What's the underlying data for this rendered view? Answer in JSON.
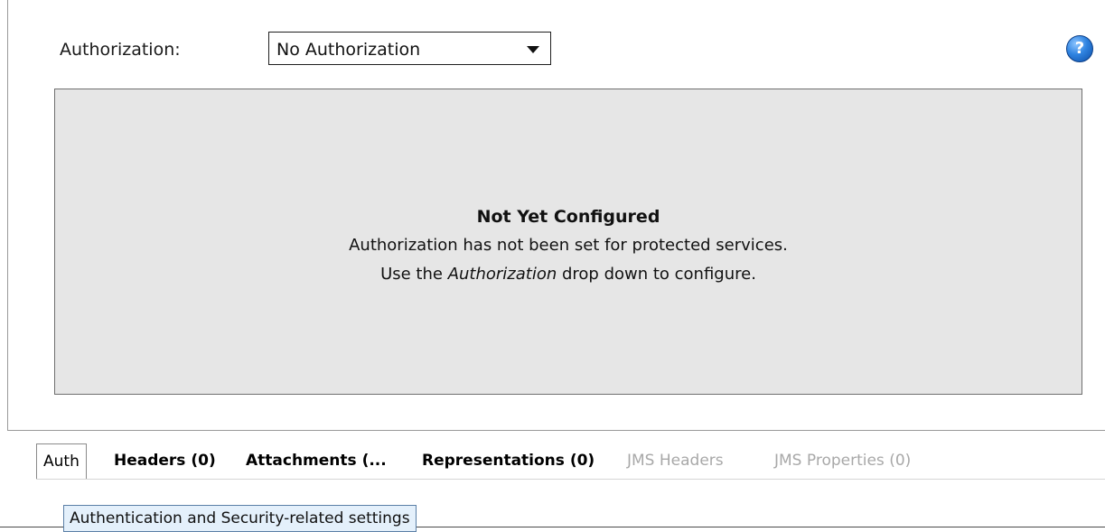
{
  "authorization": {
    "label": "Authorization:",
    "selected": "No Authorization",
    "help_icon": "question-mark"
  },
  "not_configured": {
    "title": "Not Yet Configured",
    "line1": "Authorization has not been set for protected services.",
    "line2_prefix": "Use the ",
    "line2_emphasis": "Authorization",
    "line2_suffix": " drop down to configure."
  },
  "tabs": [
    {
      "label": "Auth",
      "state": "active"
    },
    {
      "label": "Headers (0)",
      "state": "enabled"
    },
    {
      "label": "Attachments (...",
      "state": "enabled"
    },
    {
      "label": "Representations (0)",
      "state": "enabled"
    },
    {
      "label": "JMS Headers",
      "state": "disabled"
    },
    {
      "label": "JMS Properties (0)",
      "state": "disabled"
    }
  ],
  "tooltip": "Authentication and Security-related settings",
  "colors": {
    "panel_bg": "#e6e6e6",
    "disabled_text": "#a8a8a8",
    "tooltip_bg": "#e4f0fb",
    "help_blue": "#2f83e0"
  }
}
